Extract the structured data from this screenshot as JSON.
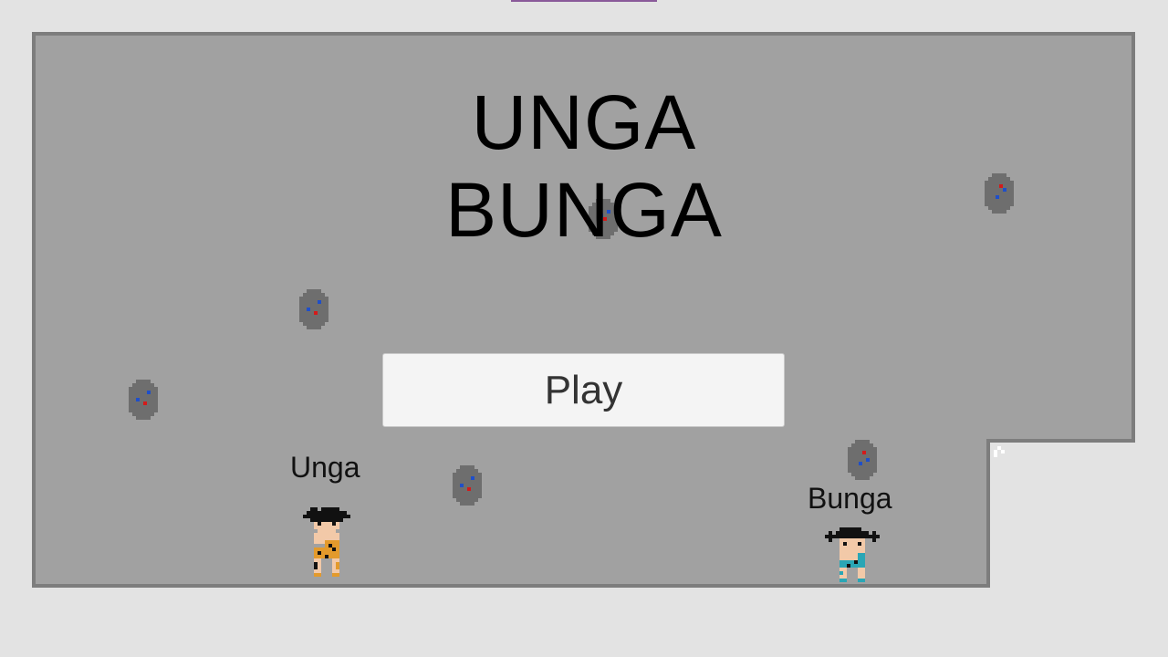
{
  "game": {
    "title_line1": "UNGA",
    "title_line2": "BUNGA",
    "play_label": "Play"
  },
  "players": {
    "left_name": "Unga",
    "right_name": "Bunga"
  },
  "colors": {
    "background": "#e3e3e3",
    "floor": "#a1a1a1",
    "wall_border": "#7d7d7d",
    "rock": "#6e6e6e",
    "gem_blue": "#1f4fc9",
    "gem_red": "#d41a1a",
    "unga_outfit": "#e39a2c",
    "bunga_outfit": "#2aa6b5",
    "skin": "#f2c9a8",
    "hair": "#111111"
  },
  "icons": {
    "rock": "rock-with-gems-icon",
    "unga": "caveman-orange-sprite",
    "bunga": "caveman-teal-sprite"
  }
}
